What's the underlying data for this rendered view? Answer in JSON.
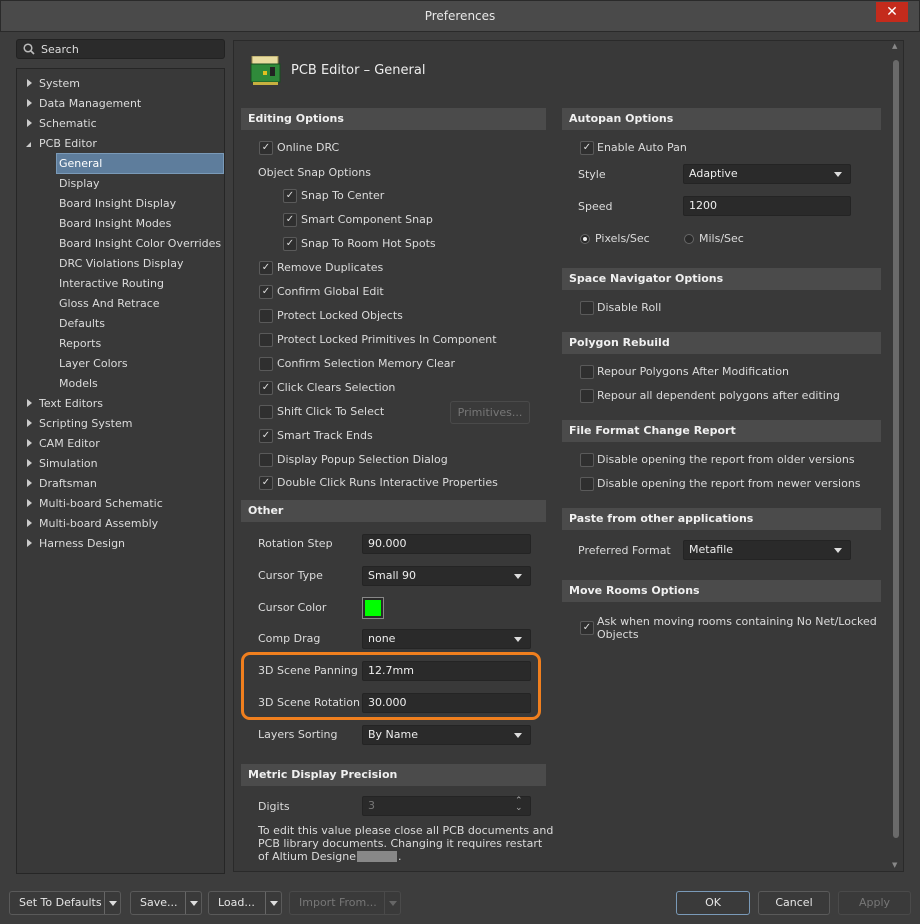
{
  "window": {
    "title": "Preferences",
    "close": "✕"
  },
  "search": {
    "placeholder": "Search"
  },
  "tree": [
    {
      "label": "System",
      "level": 0,
      "expanded": false
    },
    {
      "label": "Data Management",
      "level": 0,
      "expanded": false
    },
    {
      "label": "Schematic",
      "level": 0,
      "expanded": false
    },
    {
      "label": "PCB Editor",
      "level": 0,
      "expanded": true
    },
    {
      "label": "General",
      "level": 1,
      "selected": true
    },
    {
      "label": "Display",
      "level": 1
    },
    {
      "label": "Board Insight Display",
      "level": 1
    },
    {
      "label": "Board Insight Modes",
      "level": 1
    },
    {
      "label": "Board Insight Color Overrides",
      "level": 1
    },
    {
      "label": "DRC Violations Display",
      "level": 1
    },
    {
      "label": "Interactive Routing",
      "level": 1
    },
    {
      "label": "Gloss And Retrace",
      "level": 1
    },
    {
      "label": "Defaults",
      "level": 1
    },
    {
      "label": "Reports",
      "level": 1
    },
    {
      "label": "Layer Colors",
      "level": 1
    },
    {
      "label": "Models",
      "level": 1
    },
    {
      "label": "Text Editors",
      "level": 0,
      "expanded": false
    },
    {
      "label": "Scripting System",
      "level": 0,
      "expanded": false
    },
    {
      "label": "CAM Editor",
      "level": 0,
      "expanded": false
    },
    {
      "label": "Simulation",
      "level": 0,
      "expanded": false
    },
    {
      "label": "Draftsman",
      "level": 0,
      "expanded": false
    },
    {
      "label": "Multi-board Schematic",
      "level": 0,
      "expanded": false
    },
    {
      "label": "Multi-board Assembly",
      "level": 0,
      "expanded": false
    },
    {
      "label": "Harness Design",
      "level": 0,
      "expanded": false
    }
  ],
  "page": {
    "title": "PCB Editor – General"
  },
  "editing": {
    "header": "Editing Options",
    "snap_label": "Object Snap Options",
    "primitives_button": "Primitives...",
    "items": [
      {
        "label": "Online DRC",
        "checked": true
      },
      {
        "label": "Snap To Center",
        "checked": true
      },
      {
        "label": "Smart Component Snap",
        "checked": true
      },
      {
        "label": "Snap To Room Hot Spots",
        "checked": true
      },
      {
        "label": "Remove Duplicates",
        "checked": true
      },
      {
        "label": "Confirm Global Edit",
        "checked": true
      },
      {
        "label": "Protect Locked Objects",
        "checked": false
      },
      {
        "label": "Protect Locked Primitives In Component",
        "checked": false
      },
      {
        "label": "Confirm Selection Memory Clear",
        "checked": false
      },
      {
        "label": "Click Clears Selection",
        "checked": true
      },
      {
        "label": "Shift Click To Select",
        "checked": false
      },
      {
        "label": "Smart Track Ends",
        "checked": true
      },
      {
        "label": "Display Popup Selection Dialog",
        "checked": false
      },
      {
        "label": "Double Click Runs Interactive Properties",
        "checked": true
      }
    ]
  },
  "other": {
    "header": "Other",
    "rows": [
      {
        "label": "Rotation Step",
        "value": "90.000",
        "type": "input"
      },
      {
        "label": "Cursor Type",
        "value": "Small 90",
        "type": "dropdown"
      },
      {
        "label": "Cursor Color",
        "value": "",
        "type": "color"
      },
      {
        "label": "Comp Drag",
        "value": "none",
        "type": "dropdown"
      },
      {
        "label": "3D Scene Panning",
        "value": "12.7mm",
        "type": "input"
      },
      {
        "label": "3D Scene Rotation",
        "value": "30.000",
        "type": "input"
      },
      {
        "label": "Layers Sorting",
        "value": "By Name",
        "type": "dropdown"
      }
    ],
    "cursor_color": "#00ff00",
    "highlight_color": "#f07f1e"
  },
  "metric": {
    "header": "Metric Display Precision",
    "digits_label": "Digits",
    "digits_value": "3",
    "note_lines": [
      "To edit this value please close all PCB documents and",
      "PCB library documents. Changing it requires restart",
      "of Altium Designer"
    ],
    "note_end": "."
  },
  "autopan": {
    "header": "Autopan Options",
    "enable": {
      "label": "Enable Auto Pan",
      "checked": true
    },
    "style_label": "Style",
    "style_value": "Adaptive",
    "speed_label": "Speed",
    "speed_value": "1200",
    "radio_pixels": "Pixels/Sec",
    "radio_mils": "Mils/Sec",
    "selected": "Pixels/Sec"
  },
  "spacenav": {
    "header": "Space Navigator Options",
    "disable_roll": {
      "label": "Disable Roll",
      "checked": false
    }
  },
  "polygon": {
    "header": "Polygon Rebuild",
    "items": [
      {
        "label": "Repour Polygons After Modification",
        "checked": false
      },
      {
        "label": "Repour all dependent polygons after editing",
        "checked": false
      }
    ]
  },
  "fileformat": {
    "header": "File Format Change Report",
    "items": [
      {
        "label": "Disable opening the report from older versions",
        "checked": false
      },
      {
        "label": "Disable opening the report from newer versions",
        "checked": false
      }
    ]
  },
  "paste": {
    "header": "Paste from other applications",
    "format_label": "Preferred Format",
    "format_value": "Metafile"
  },
  "moverooms": {
    "header": "Move Rooms Options",
    "item": {
      "label_line1": "Ask when moving rooms containing No Net/Locked",
      "label_line2": "Objects",
      "checked": true
    }
  },
  "footer": {
    "set_defaults": "Set To Defaults",
    "save": "Save...",
    "load": "Load...",
    "import": "Import From...",
    "ok": "OK",
    "cancel": "Cancel",
    "apply": "Apply"
  }
}
